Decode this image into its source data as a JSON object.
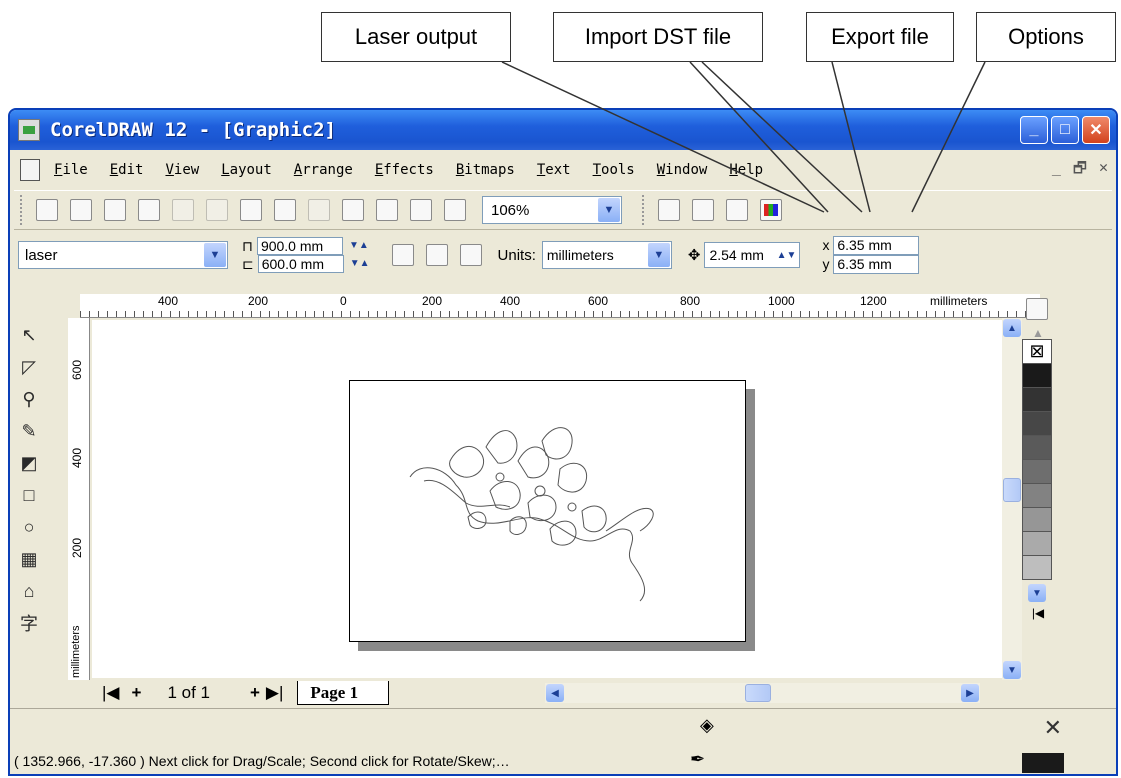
{
  "callouts": {
    "laser_output": "Laser output",
    "import_dst": "Import DST file",
    "export_file": "Export file",
    "options": "Options"
  },
  "window": {
    "title": "CorelDRAW 12 - [Graphic2]",
    "controls": {
      "minimize": "_",
      "maximize": "□",
      "close": "✕"
    }
  },
  "menubar": {
    "items": [
      "File",
      "Edit",
      "View",
      "Layout",
      "Arrange",
      "Effects",
      "Bitmaps",
      "Text",
      "Tools",
      "Window",
      "Help"
    ],
    "doc_controls": [
      "_",
      "🗗",
      "✕"
    ]
  },
  "toolbar": {
    "zoom": "106%"
  },
  "property_bar": {
    "preset": "laser",
    "width": "900.0 mm",
    "height": "600.0 mm",
    "units_label": "Units:",
    "units_value": "millimeters",
    "nudge": "2.54 mm",
    "dup_x_label": "x",
    "dup_x": "6.35 mm",
    "dup_y_label": "y",
    "dup_y": "6.35 mm"
  },
  "rulers": {
    "h_ticks": [
      "400",
      "200",
      "0",
      "200",
      "400",
      "600",
      "800",
      "1000",
      "1200"
    ],
    "h_unit": "millimeters",
    "v_ticks": [
      "600",
      "400",
      "200"
    ],
    "v_unit": "millimeters"
  },
  "page_nav": {
    "first": "|◀",
    "add_before": "+",
    "counter": "1 of 1",
    "add_after": "+",
    "last": "▶|",
    "tab": "Page 1"
  },
  "status": {
    "text": "( 1352.966, -17.360 )  Next click for Drag/Scale; Second click for Rotate/Skew;…"
  },
  "icons": {
    "toolbox": [
      "pick-tool-icon",
      "shape-tool-icon",
      "zoom-tool-icon",
      "freehand-tool-icon",
      "smart-fill-icon",
      "rectangle-tool-icon",
      "ellipse-tool-icon",
      "graph-paper-icon",
      "basic-shapes-icon",
      "text-tool-icon"
    ]
  },
  "colors": {
    "titlebar": "#1f5fdc",
    "chrome": "#ece9d8",
    "palette": [
      "#ffffff",
      "#1a1a1a",
      "#333333",
      "#474747",
      "#5a5a5a",
      "#6e6e6e",
      "#828282",
      "#969696",
      "#aaaaaa",
      "#bebebe"
    ]
  }
}
